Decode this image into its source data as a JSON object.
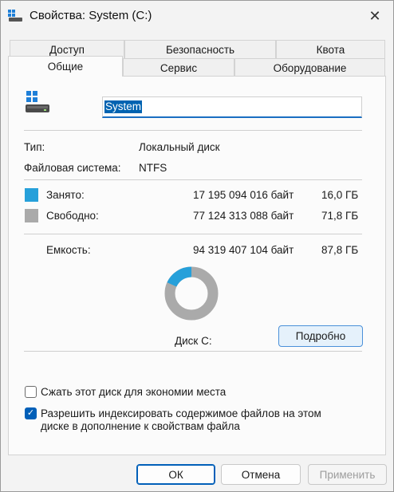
{
  "window": {
    "title": "Свойства: System (C:)"
  },
  "tabs": {
    "row1": [
      "Доступ",
      "Безопасность",
      "Квота"
    ],
    "row2": [
      "Общие",
      "Сервис",
      "Оборудование"
    ],
    "active": "Общие"
  },
  "general": {
    "name_value": "System",
    "type_label": "Тип:",
    "type_value": "Локальный диск",
    "fs_label": "Файловая система:",
    "fs_value": "NTFS",
    "used": {
      "label": "Занято:",
      "bytes": "17 195 094 016 байт",
      "size": "16,0 ГБ",
      "color": "#26a0da"
    },
    "free": {
      "label": "Свободно:",
      "bytes": "77 124 313 088 байт",
      "size": "71,8 ГБ",
      "color": "#aaaaaa"
    },
    "capacity": {
      "label": "Емкость:",
      "bytes": "94 319 407 104 байт",
      "size": "87,8 ГБ"
    },
    "disk_label": "Диск C:",
    "details_button": "Подробно",
    "used_fraction": 0.1823
  },
  "options": {
    "compress": {
      "label": "Сжать этот диск для экономии места",
      "checked": false
    },
    "index": {
      "label_line1": "Разрешить индексировать содержимое файлов на этом",
      "label_line2": "диске в дополнение к свойствам файла",
      "checked": true
    }
  },
  "footer": {
    "ok": "ОК",
    "cancel": "Отмена",
    "apply": "Применить"
  }
}
